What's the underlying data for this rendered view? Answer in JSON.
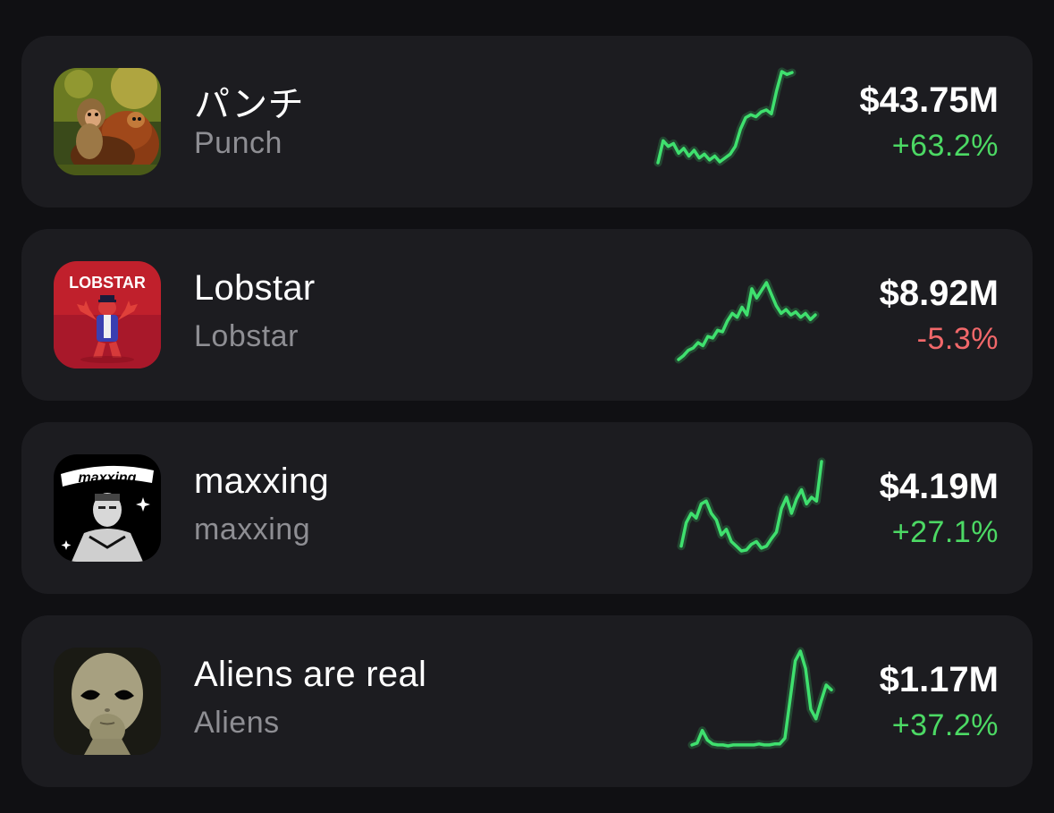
{
  "colors": {
    "background": "#101013",
    "card": "#1c1c20",
    "positive": "#4cd964",
    "negative": "#f2686a",
    "sparkline": "#3fe06e",
    "secondary_text": "#8e8e93"
  },
  "tokens": [
    {
      "name": "パンチ",
      "ticker": "Punch",
      "market_cap": "$43.75M",
      "change": "+63.2%",
      "direction": "up",
      "avatar": "monkey-in-jungle-avatar",
      "sparkline": [
        5,
        28,
        22,
        25,
        15,
        20,
        12,
        18,
        10,
        14,
        8,
        12,
        6,
        10,
        14,
        22,
        40,
        52,
        55,
        53,
        58,
        60,
        56,
        80,
        100,
        97,
        99
      ]
    },
    {
      "name": "Lobstar",
      "ticker": "Lobstar",
      "market_cap": "$8.92M",
      "change": "-5.3%",
      "direction": "down",
      "avatar": "lobstar-mascot-avatar",
      "sparkline": [
        0,
        5,
        12,
        15,
        22,
        18,
        30,
        28,
        38,
        36,
        50,
        60,
        55,
        68,
        58,
        92,
        80,
        90,
        100,
        85,
        70,
        60,
        65,
        58,
        62,
        55,
        60,
        52,
        58
      ]
    },
    {
      "name": "maxxing",
      "ticker": "maxxing",
      "market_cap": "$4.19M",
      "change": "+27.1%",
      "direction": "up",
      "avatar": "maxxing-portrait-avatar",
      "sparkline": [
        10,
        35,
        45,
        40,
        55,
        58,
        45,
        38,
        22,
        28,
        15,
        10,
        5,
        6,
        12,
        15,
        8,
        10,
        18,
        25,
        50,
        62,
        45,
        60,
        70,
        55,
        62,
        58,
        100
      ]
    },
    {
      "name": "Aliens are real",
      "ticker": "Aliens",
      "market_cap": "$1.17M",
      "change": "+37.2%",
      "direction": "up",
      "avatar": "alien-portrait-avatar",
      "sparkline": [
        3,
        5,
        18,
        8,
        4,
        3,
        3,
        2,
        3,
        3,
        3,
        3,
        3,
        4,
        3,
        3,
        4,
        4,
        10,
        50,
        90,
        100,
        82,
        40,
        30,
        48,
        65,
        60
      ]
    }
  ]
}
